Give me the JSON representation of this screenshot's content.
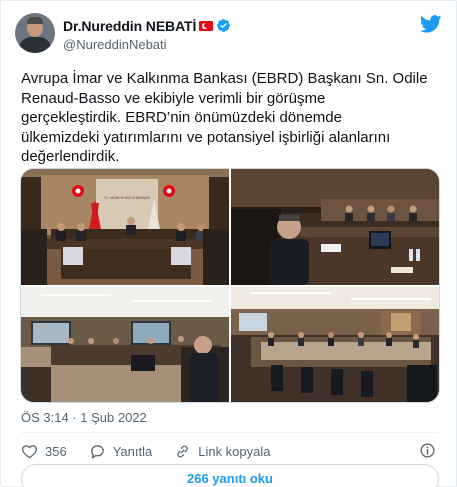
{
  "author": {
    "display_name": "Dr.Nureddin NEBATİ",
    "handle": "@NureddinNebati",
    "verified": true
  },
  "brand_icon": "twitter-bird-icon",
  "tweet": {
    "text_lines": [
      "Avrupa İmar ve Kalkınma Bankası (EBRD) Başkanı Sn. Odile",
      "Renaud-Basso ve ekibiyle verimli bir görüşme",
      "gerçekleştirdik. EBRD’nin önümüzdeki dönemde",
      "ülkemizdeki yatırımlarını ve potansiyel işbirliği alanlarını",
      "değerlendirdik."
    ],
    "photos": [
      "meeting-photo-1",
      "meeting-photo-2",
      "meeting-photo-3",
      "meeting-photo-4"
    ],
    "photo1_wall_text": "T.C. HAZİNE VE MALİYE BAKANLIĞI",
    "timestamp": "ÖS 3:14 · 1 Şub 2022"
  },
  "actions": {
    "like_count": "356",
    "reply_label": "Yanıtla",
    "copy_link_label": "Link kopyala"
  },
  "read_replies_label": "266 yanıtı oku",
  "colors": {
    "accent": "#1d9bf0",
    "secondary_text": "#536471",
    "border": "#cfd9de",
    "flag_red": "#e30a17"
  }
}
